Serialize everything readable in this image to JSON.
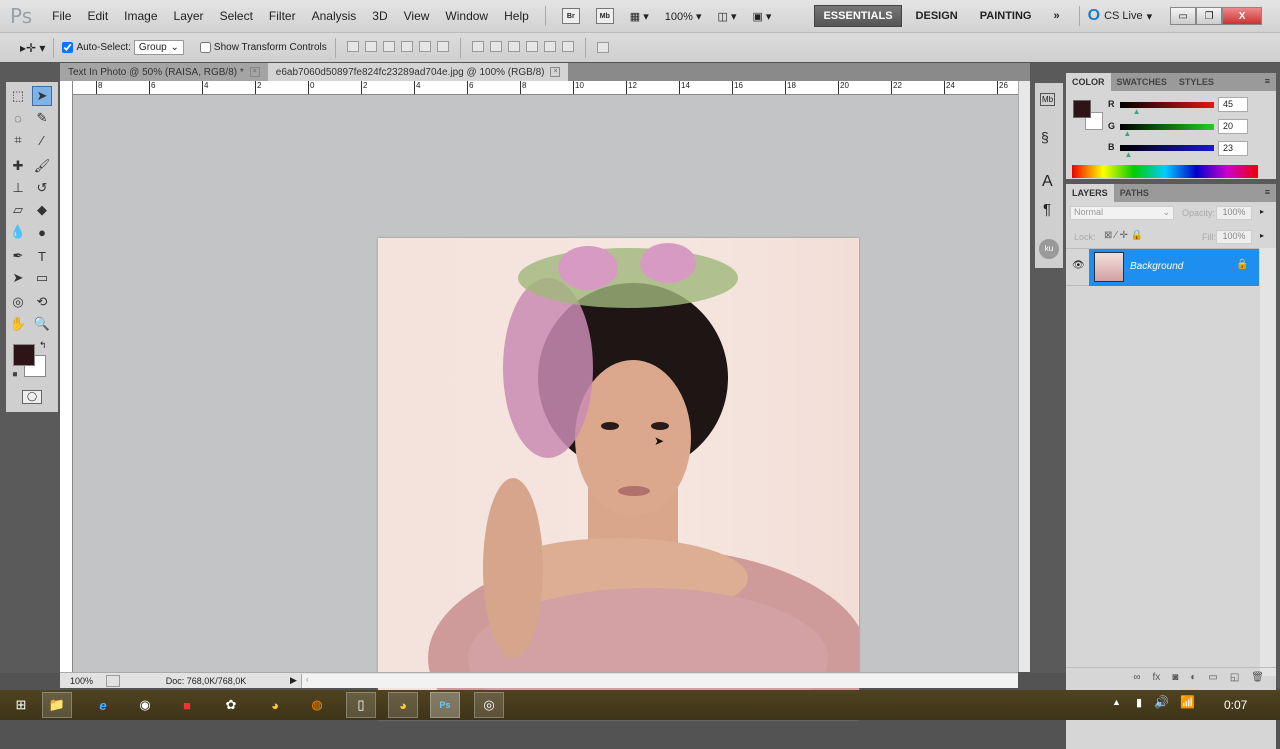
{
  "app": {
    "logo": "Ps"
  },
  "menu": [
    "File",
    "Edit",
    "Image",
    "Layer",
    "Select",
    "Filter",
    "Analysis",
    "3D",
    "View",
    "Window",
    "Help"
  ],
  "appbar": {
    "bridge": "Br",
    "minibridge": "Mb",
    "zoom": "100%"
  },
  "workspaces": {
    "essentials": "ESSENTIALS",
    "design": "DESIGN",
    "painting": "PAINTING",
    "more": "»"
  },
  "cslive": "CS Live",
  "options": {
    "auto_select_label": "Auto-Select:",
    "auto_select_checked": true,
    "auto_select_value": "Group",
    "show_transform_label": "Show Transform Controls",
    "show_transform_checked": false
  },
  "tabs": [
    {
      "label": "Text In Photo @ 50% (RAISA, RGB/8) *",
      "active": false
    },
    {
      "label": "e6ab7060d50897fe824fc23289ad704e.jpg @ 100% (RGB/8)",
      "active": true
    }
  ],
  "ruler": {
    "h_ticks": [
      "8",
      "6",
      "4",
      "2",
      "0",
      "2",
      "4",
      "6",
      "8",
      "10",
      "12",
      "14",
      "16",
      "18",
      "20",
      "22",
      "24",
      "26"
    ]
  },
  "status": {
    "zoom": "100%",
    "doc": "Doc: 768,0K/768,0K"
  },
  "color_panel": {
    "tabs": [
      "COLOR",
      "SWATCHES",
      "STYLES"
    ],
    "r_label": "R",
    "g_label": "G",
    "b_label": "B",
    "r": "45",
    "g": "20",
    "b": "23",
    "foreground": "#2d1417",
    "background": "#ffffff"
  },
  "layers_panel": {
    "tabs": [
      "LAYERS",
      "PATHS"
    ],
    "blend_mode": "Normal",
    "opacity_label": "Opacity:",
    "opacity": "100%",
    "lock_label": "Lock:",
    "fill_label": "Fill:",
    "fill": "100%",
    "layers": [
      {
        "name": "Background",
        "visible": true,
        "locked": true,
        "selected": true
      }
    ]
  },
  "taskbar": {
    "clock": "0:07"
  },
  "colors": {
    "accent": "#1e8fef",
    "menubar": "#d6d6d6",
    "canvas": "#c2c4c6"
  }
}
